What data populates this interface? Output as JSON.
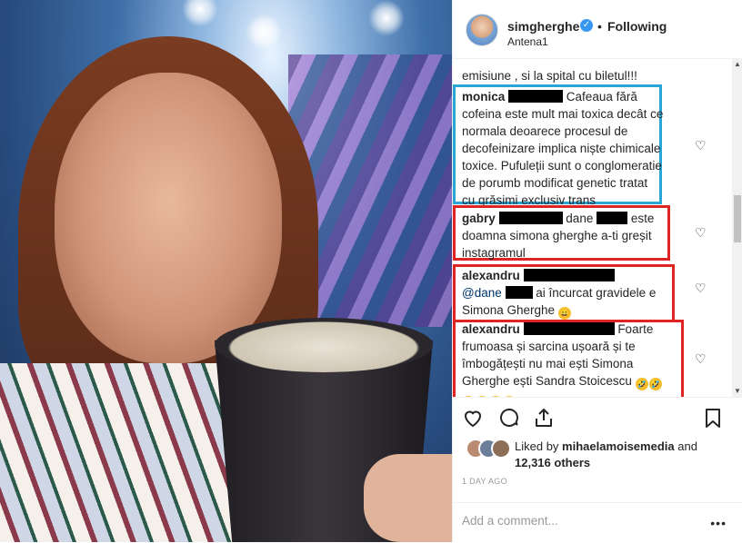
{
  "post": {
    "username": "simgherghe",
    "follow_state": "Following",
    "separator": "•",
    "location": "Antena1"
  },
  "comments": [
    {
      "text": "emisiune , si la spital cu biletul!!!"
    },
    {
      "user": "monica",
      "text": "Cafeaua fără cofeina este mult mai toxica decât ce normala deoarece procesul de decofeinizare implica niște chimicale toxice. Pufuleții sunt o conglomeratie de porumb modificat genetic tratat cu grăsimi exclusiv trans",
      "highlight": "blue"
    },
    {
      "user": "gabry",
      "mention": "dane",
      "text": "este doamna simona gherghe a-ti greșit instagramul",
      "highlight": "red"
    },
    {
      "user": "alexandru",
      "mention": "@dane",
      "text": "ai încurcat gravidele e Simona Gherghe",
      "emoji": "😄",
      "highlight": "red"
    },
    {
      "user": "alexandru",
      "text": "Foarte frumoasa și sarcina ușoară și te îmbogățești nu mai ești Simona Gherghe ești Sandra Stoicescu",
      "emojis": [
        "🤣",
        "🤣",
        "🤣",
        "🤣",
        "🤣",
        "🤣"
      ],
      "highlight": "red"
    }
  ],
  "likes": {
    "prefix": "Liked by",
    "user": "mihaelamoisemedia",
    "conj": "and",
    "count": "12,316 others"
  },
  "timestamp": "1 DAY AGO",
  "add_comment_placeholder": "Add a comment...",
  "more_label": "•••",
  "icons": {
    "verified": "verified-badge-icon",
    "heart": "heart-icon",
    "comment": "comment-icon",
    "share": "share-icon",
    "save": "bookmark-icon"
  },
  "colors": {
    "verified": "#3897f0",
    "highlight_blue": "#2aa6d6",
    "highlight_red": "#e02424"
  }
}
